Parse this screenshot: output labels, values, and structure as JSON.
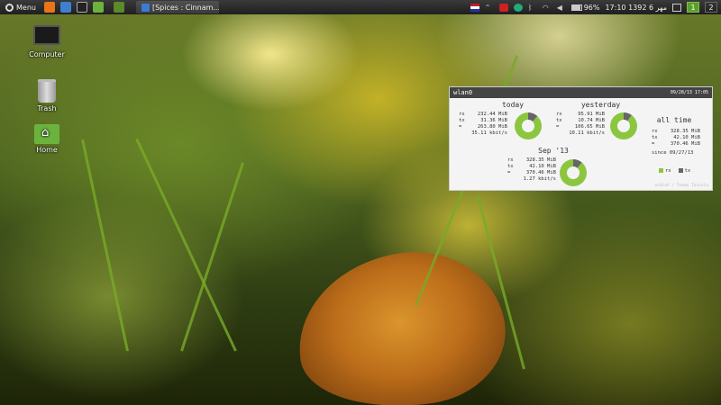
{
  "panel": {
    "menu_label": "Menu",
    "task_label": "[Spices : Cinnam...",
    "battery": "96%",
    "clock": "17:10 1392 مهر 6",
    "workspaces": [
      "1",
      "2"
    ]
  },
  "desktop": {
    "icons": [
      {
        "label": "Computer",
        "icon": "computer-icon"
      },
      {
        "label": "Trash",
        "icon": "trash-icon"
      },
      {
        "label": "Home",
        "icon": "home-folder-icon"
      }
    ]
  },
  "widget": {
    "interface": "wlan0",
    "datetime": "09/28/13 17:05",
    "today": {
      "title": "today",
      "rx": "232.44 MiB",
      "tx": "31.36 MiB",
      "total": "263.80 MiB",
      "rate": "35.11 kbit/s",
      "rx_fraction": 0.88
    },
    "yesterday": {
      "title": "yesterday",
      "rx": "95.91 MiB",
      "tx": "10.74 MiB",
      "total": "106.65 MiB",
      "rate": "10.11 kbit/s",
      "rx_fraction": 0.9
    },
    "month": {
      "title": "Sep '13",
      "rx": "328.35 MiB",
      "tx": "42.10 MiB",
      "total": "370.46 MiB",
      "rate": "1.27 kbit/s",
      "rx_fraction": 0.89
    },
    "alltime": {
      "title": "all time",
      "rx": "328.35 MiB",
      "tx": "42.10 MiB",
      "total": "370.46 MiB",
      "since": "since 09/27/13"
    },
    "labels": {
      "rx": "rx",
      "tx": "tx",
      "eq": "="
    },
    "legend": {
      "rx": "rx",
      "tx": "tx"
    },
    "credit": "vnStat / Teemu Toivola",
    "colors": {
      "rx": "#8cc63f",
      "tx": "#666666"
    }
  }
}
